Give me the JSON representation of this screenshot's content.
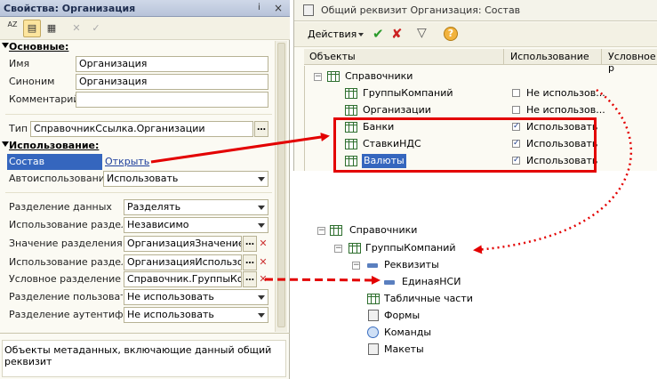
{
  "left_panel": {
    "title": "Свойства: Организация",
    "title_buttons": [
      "ⅰ",
      "×"
    ],
    "toolbar": {
      "sort_label": "AZ",
      "close": "✕",
      "ok": "✓"
    },
    "sections": {
      "main": "Основные:",
      "usage": "Использование:"
    },
    "fields": {
      "name_label": "Имя",
      "name_value": "Организация",
      "synonym_label": "Синоним",
      "synonym_value": "Организация",
      "comment_label": "Комментарий",
      "comment_value": "",
      "type_label": "Тип",
      "type_value": "СправочникСсылка.Организации",
      "composition_label": "Состав",
      "composition_link": "Открыть",
      "autouse_label": "Автоиспользование",
      "autouse_value": "Использовать",
      "separation_label": "Разделение данных",
      "separation_value": "Разделять",
      "sep_use_label": "Использование разделения",
      "sep_use_value": "Независимо",
      "sep_value_label": "Значение разделения данных",
      "sep_value_value": "ОрганизацияЗначение",
      "sep_use2_label": "Использование разделения",
      "sep_use2_value": "ОрганизацияИспользование",
      "cond_sep_label": "Условное разделение",
      "cond_sep_value": "Справочник.ГруппыКомпаний",
      "user_sep_label": "Разделение пользователей",
      "user_sep_value": "Не использовать",
      "auth_sep_label": "Разделение аутентификации",
      "auth_sep_value": "Не использовать"
    },
    "description": "Объекты метаданных, включающие данный общий реквизит",
    "dots": "…",
    "x": "✕"
  },
  "right_panel": {
    "title": "Общий реквизит Организация: Состав",
    "actions_label": "Действия",
    "columns": [
      "Объекты",
      "Использование",
      "Условное р"
    ],
    "root": "Справочники",
    "rows": [
      {
        "name": "ГруппыКомпаний",
        "usage": "Не использов...",
        "checked": false
      },
      {
        "name": "Организации",
        "usage": "Не использов...",
        "checked": false
      },
      {
        "name": "Банки",
        "usage": "Использовать",
        "checked": true
      },
      {
        "name": "СтавкиНДС",
        "usage": "Использовать",
        "checked": true
      },
      {
        "name": "Валюты",
        "usage": "Использовать",
        "checked": true
      }
    ]
  },
  "tree": {
    "root": "Справочники",
    "group": "ГруппыКомпаний",
    "attrs": "Реквизиты",
    "attr_item": "ЕдинаяНСИ",
    "tables": "Табличные части",
    "forms": "Формы",
    "commands": "Команды",
    "layouts": "Макеты"
  },
  "colors": {
    "accent": "#3566be",
    "arrow": "#e30000"
  }
}
